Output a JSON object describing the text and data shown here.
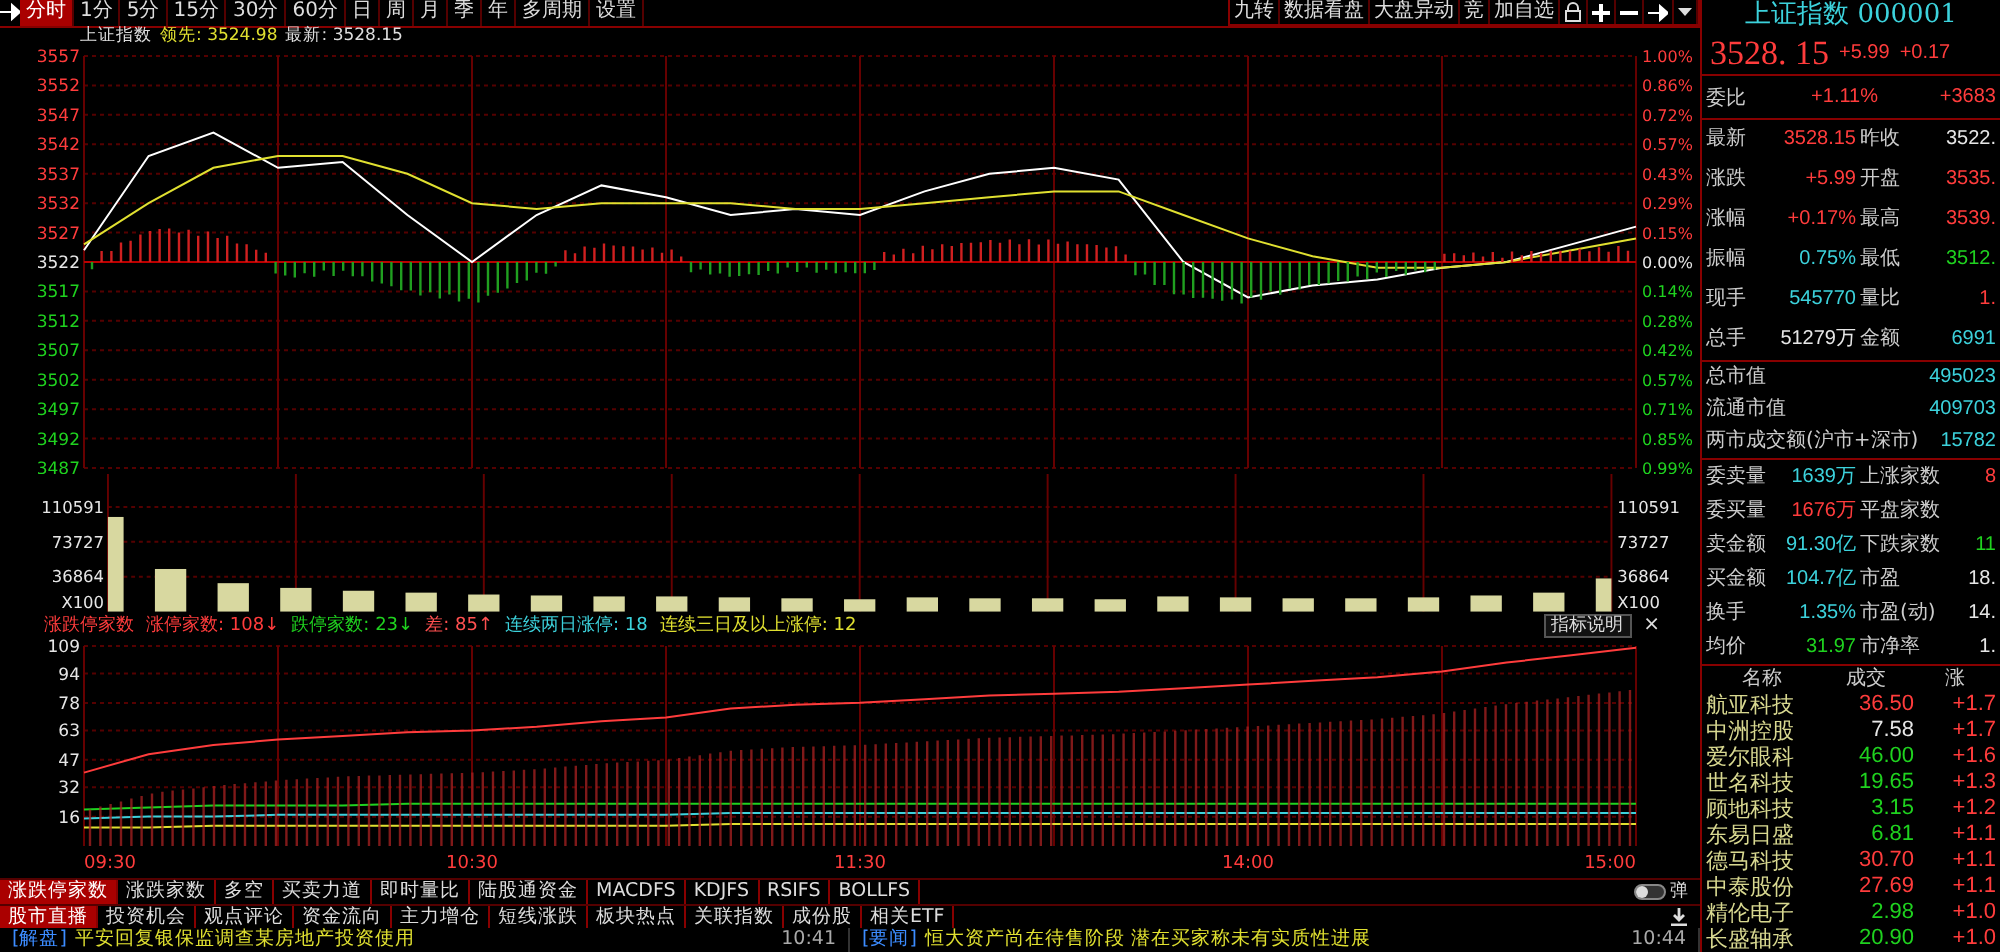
{
  "toolbar": {
    "tabs": [
      {
        "label": "分时",
        "selected": true
      },
      {
        "label": "1分",
        "selected": false
      },
      {
        "label": "5分",
        "selected": false
      },
      {
        "label": "15分",
        "selected": false
      },
      {
        "label": "30分",
        "selected": false
      },
      {
        "label": "60分",
        "selected": false
      },
      {
        "label": "日",
        "selected": false
      },
      {
        "label": "周",
        "selected": false
      },
      {
        "label": "月",
        "selected": false
      },
      {
        "label": "季",
        "selected": false
      },
      {
        "label": "年",
        "selected": false
      },
      {
        "label": "多周期",
        "selected": false
      },
      {
        "label": "设置",
        "selected": false
      }
    ],
    "tools": [
      {
        "kind": "text",
        "label": "九转"
      },
      {
        "kind": "text",
        "label": "数据看盘"
      },
      {
        "kind": "text",
        "label": "大盘异动"
      },
      {
        "kind": "text",
        "label": "竞"
      },
      {
        "kind": "text",
        "label": "加自选"
      },
      {
        "kind": "lock"
      },
      {
        "kind": "plus"
      },
      {
        "kind": "minus"
      },
      {
        "kind": "pin"
      },
      {
        "kind": "dropdown"
      }
    ]
  },
  "info": {
    "name": "上证指数",
    "lead_label": "领先:",
    "lead_value": "3524.98",
    "last_label": "最新:",
    "last_value": "3528.15"
  },
  "price_chart": {
    "right_axis_labels": [
      "1.00%",
      "0.86%",
      "0.72%",
      "0.57%",
      "0.43%",
      "0.29%",
      "0.15%",
      "0.00%",
      "0.14%",
      "0.28%",
      "0.42%",
      "0.57%",
      "0.71%",
      "0.85%",
      "0.99%"
    ],
    "chart_data": {
      "type": "line",
      "categories": [
        null,
        null,
        null,
        null,
        null,
        null,
        null,
        null,
        null,
        null,
        null,
        null,
        null,
        null,
        null,
        null,
        null,
        null,
        null,
        null,
        null,
        null,
        null,
        null,
        null
      ],
      "series": [
        {
          "color": "#ffffff",
          "values": [
            3524,
            3540,
            3544,
            3538,
            3539,
            3530,
            3522,
            3530,
            3535,
            3533,
            3530,
            3531,
            3530,
            3534,
            3537,
            3538,
            3536,
            3522,
            3516,
            3518,
            3519,
            3521,
            3522,
            3525,
            3528
          ]
        },
        {
          "color": "#e0e030",
          "values": [
            3525,
            3532,
            3538,
            3540,
            3540,
            3537,
            3532,
            3531,
            3532,
            3532,
            3532,
            3531,
            3531,
            3532,
            3533,
            3534,
            3534,
            3530,
            3526,
            3523,
            3521,
            3521,
            3522,
            3524,
            3526
          ]
        }
      ],
      "ref_lines": [
        {
          "axis": "y",
          "value": 3522
        }
      ],
      "ylim": [
        3487,
        3557
      ],
      "yticks": [
        3557,
        3552,
        3547,
        3542,
        3537,
        3532,
        3527,
        3522,
        3517,
        3512,
        3507,
        3502,
        3497,
        3492,
        3487
      ],
      "grid": true
    }
  },
  "volume_chart": {
    "unit_label": "X100",
    "right_axis_labels": [
      "110591",
      "73727",
      "36864",
      "X100"
    ],
    "chart_data": {
      "type": "bar",
      "categories": [
        null,
        null,
        null,
        null,
        null,
        null,
        null,
        null,
        null,
        null,
        null,
        null,
        null,
        null,
        null,
        null,
        null,
        null,
        null,
        null,
        null,
        null,
        null,
        null,
        null
      ],
      "series": [
        {
          "color": "#d8d8a0",
          "values": [
            100000,
            45000,
            30000,
            25000,
            22000,
            20000,
            18000,
            17000,
            16000,
            16000,
            15000,
            14000,
            13000,
            15000,
            14000,
            14000,
            13000,
            16000,
            15000,
            14000,
            14000,
            15000,
            17000,
            20000,
            35000
          ]
        }
      ],
      "ylim": [
        0,
        110591
      ],
      "yticks": [
        110591,
        73727,
        36864
      ],
      "grid": true
    }
  },
  "limit_legend": {
    "title": "涨跌停家数",
    "items": [
      {
        "label": "涨停家数:",
        "value": "108",
        "arrow": "↓",
        "color": "#ff3c3c"
      },
      {
        "label": "跌停家数:",
        "value": "23",
        "arrow": "↓",
        "color": "#1fd21f"
      },
      {
        "label": "差:",
        "value": "85",
        "arrow": "↑",
        "color": "#ff5050"
      },
      {
        "label": "连续两日涨停:",
        "value": "18",
        "color": "#3cd2dc"
      },
      {
        "label": "连续三日及以上涨停:",
        "value": "12",
        "color": "#e0e030"
      }
    ],
    "help_button": "指标说明",
    "close": "×"
  },
  "limit_chart": {
    "chart_data": {
      "type": "line",
      "categories": [
        "09:30",
        null,
        null,
        null,
        null,
        null,
        "10:30",
        null,
        null,
        null,
        null,
        null,
        "11:30",
        null,
        null,
        null,
        null,
        null,
        "14:00",
        null,
        null,
        null,
        null,
        null,
        "15:00"
      ],
      "series": [
        {
          "color": "#ff3c3c",
          "values": [
            40,
            50,
            55,
            58,
            60,
            62,
            63,
            65,
            68,
            70,
            75,
            77,
            78,
            80,
            82,
            83,
            84,
            86,
            88,
            90,
            92,
            95,
            100,
            104,
            108
          ]
        },
        {
          "color": "#1fd21f",
          "values": [
            20,
            21,
            22,
            22,
            22,
            23,
            23,
            23,
            23,
            23,
            23,
            23,
            23,
            23,
            23,
            23,
            23,
            23,
            23,
            23,
            23,
            23,
            23,
            23,
            23
          ]
        },
        {
          "color": "#3cd2dc",
          "values": [
            15,
            16,
            16,
            17,
            17,
            17,
            17,
            17,
            17,
            17,
            18,
            18,
            18,
            18,
            18,
            18,
            18,
            18,
            18,
            18,
            18,
            18,
            18,
            18,
            18
          ]
        },
        {
          "color": "#e0e030",
          "values": [
            10,
            10,
            11,
            11,
            11,
            11,
            11,
            11,
            11,
            11,
            12,
            12,
            12,
            12,
            12,
            12,
            12,
            12,
            12,
            12,
            12,
            12,
            12,
            12,
            12
          ]
        }
      ],
      "ylim": [
        0,
        109
      ],
      "yticks": [
        109,
        94,
        78,
        63,
        47,
        32,
        16
      ],
      "grid": true
    }
  },
  "indicator_tabs": [
    {
      "label": "涨跌停家数",
      "selected": true
    },
    {
      "label": "涨跌家数",
      "selected": false
    },
    {
      "label": "多空",
      "selected": false
    },
    {
      "label": "买卖力道",
      "selected": false
    },
    {
      "label": "即时量比",
      "selected": false
    },
    {
      "label": "陆股通资金",
      "selected": false
    },
    {
      "label": "MACDFS",
      "selected": false
    },
    {
      "label": "KDJFS",
      "selected": false
    },
    {
      "label": "RSIFS",
      "selected": false
    },
    {
      "label": "BOLLFS",
      "selected": false
    }
  ],
  "popup_toggle": {
    "label": "弹",
    "on": false
  },
  "news_tabs": [
    {
      "label": "股市直播",
      "selected": true
    },
    {
      "label": "投资机会",
      "selected": false
    },
    {
      "label": "观点评论",
      "selected": false
    },
    {
      "label": "资金流向",
      "selected": false
    },
    {
      "label": "主力增仓",
      "selected": false
    },
    {
      "label": "短线涨跌",
      "selected": false
    },
    {
      "label": "板块热点",
      "selected": false
    },
    {
      "label": "关联指数",
      "selected": false
    },
    {
      "label": "成份股",
      "selected": false
    },
    {
      "label": "相关ETF",
      "selected": false
    }
  ],
  "news": [
    {
      "tag": "[解盘]",
      "title": "平安回复银保监调查某房地产投资使用",
      "time": "10:41"
    },
    {
      "tag": "[要闻]",
      "title": "恒大资产尚在待售阶段 潜在买家称未有实质性进展",
      "time": "10:44"
    }
  ],
  "quote": {
    "title": "上证指数 000001",
    "price": "3528. 15",
    "change": "+5.99",
    "percent": "+0.17",
    "ratio_label": "委比",
    "ratio": "+1.11%",
    "ratio_diff": "+3683"
  },
  "stats": [
    {
      "label": "最新",
      "value": {
        "text": "3528.15",
        "color": "#ff3c3c"
      },
      "label2": "昨收",
      "value2": {
        "text": "3522.",
        "color": "#e6e6e6"
      }
    },
    {
      "label": "涨跌",
      "value": {
        "text": "+5.99",
        "color": "#ff3c3c"
      },
      "label2": "开盘",
      "value2": {
        "text": "3535.",
        "color": "#ff3c3c"
      }
    },
    {
      "label": "涨幅",
      "value": {
        "text": "+0.17%",
        "color": "#ff3c3c"
      },
      "label2": "最高",
      "value2": {
        "text": "3539.",
        "color": "#ff3c3c"
      }
    },
    {
      "label": "振幅",
      "value": {
        "text": "0.75%",
        "color": "#3cd2dc"
      },
      "label2": "最低",
      "value2": {
        "text": "3512.",
        "color": "#1fd21f"
      }
    },
    {
      "label": "现手",
      "value": {
        "text": "545770",
        "color": "#3cd2dc"
      },
      "label2": "量比",
      "value2": {
        "text": "1.",
        "color": "#ff3c3c"
      }
    },
    {
      "label": "总手",
      "value": {
        "text": "51279万",
        "color": "#e6e6e6"
      },
      "label2": "金额",
      "value2": {
        "text": "6991",
        "color": "#3cd2dc"
      }
    }
  ],
  "wide_stats": [
    {
      "label": "总市值",
      "value": {
        "text": "495023",
        "color": "#3cd2dc"
      }
    },
    {
      "label": "流通市值",
      "value": {
        "text": "409703",
        "color": "#3cd2dc"
      }
    },
    {
      "label": "两市成交额(沪市+深市)",
      "value": {
        "text": "15782",
        "color": "#3cd2dc"
      }
    }
  ],
  "stats2": [
    {
      "label": "委卖量",
      "value": {
        "text": "1639万",
        "color": "#3cd2dc"
      },
      "label2": "上涨家数",
      "value2": {
        "text": "8",
        "color": "#ff3c3c"
      }
    },
    {
      "label": "委买量",
      "value": {
        "text": "1676万",
        "color": "#ff3c3c"
      },
      "label2": "平盘家数"
    },
    {
      "label": "卖金额",
      "value": {
        "text": "91.30亿",
        "color": "#3cd2dc"
      },
      "label2": "下跌家数",
      "value2": {
        "text": "11",
        "color": "#1fd21f"
      }
    },
    {
      "label": "买金额",
      "value": {
        "text": "104.7亿",
        "color": "#3cd2dc"
      },
      "label2": "市盈",
      "value2": {
        "text": "18.",
        "color": "#e6e6e6"
      }
    },
    {
      "label": "换手",
      "value": {
        "text": "1.35%",
        "color": "#3cd2dc"
      },
      "label2": "市盈(动)",
      "value2": {
        "text": "14.",
        "color": "#e6e6e6"
      }
    },
    {
      "label": "均价",
      "value": {
        "text": "31.97",
        "color": "#1fd21f"
      },
      "label2": "市净率",
      "value2": {
        "text": "1.",
        "color": "#e6e6e6"
      }
    }
  ],
  "stock_list": {
    "columns": [
      "名称",
      "成交",
      "涨"
    ],
    "rows": [
      {
        "name": "航亚科技",
        "price": {
          "text": "36.50",
          "color": "#ff3c3c"
        },
        "change": "+1.7"
      },
      {
        "name": "中洲控股",
        "price": {
          "text": "7.58",
          "color": "#e6e6e6"
        },
        "change": "+1.7"
      },
      {
        "name": "爱尔眼科",
        "price": {
          "text": "46.00",
          "color": "#1fd21f"
        },
        "change": "+1.6"
      },
      {
        "name": "世名科技",
        "price": {
          "text": "19.65",
          "color": "#1fd21f"
        },
        "change": "+1.3"
      },
      {
        "name": "顾地科技",
        "price": {
          "text": "3.15",
          "color": "#1fd21f"
        },
        "change": "+1.2"
      },
      {
        "name": "东易日盛",
        "price": {
          "text": "6.81",
          "color": "#1fd21f"
        },
        "change": "+1.1"
      },
      {
        "name": "德马科技",
        "price": {
          "text": "30.70",
          "color": "#ff3c3c"
        },
        "change": "+1.1"
      },
      {
        "name": "中泰股份",
        "price": {
          "text": "27.69",
          "color": "#ff3c3c"
        },
        "change": "+1.1"
      },
      {
        "name": "精伦电子",
        "price": {
          "text": "2.98",
          "color": "#1fd21f"
        },
        "change": "+1.0"
      },
      {
        "name": "长盛轴承",
        "price": {
          "text": "20.90",
          "color": "#1fd21f"
        },
        "change": "+1.0"
      }
    ]
  }
}
